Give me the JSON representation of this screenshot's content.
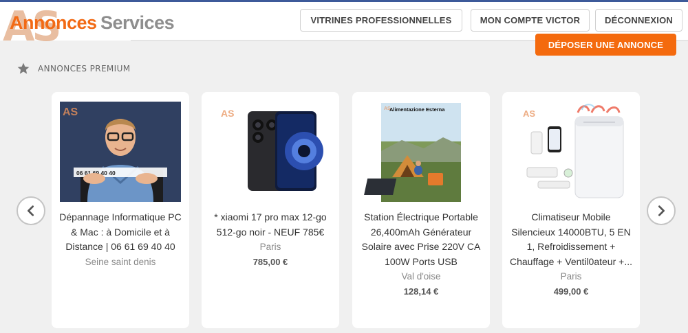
{
  "header": {
    "logo": {
      "mark": "AS",
      "word1": "Annonces",
      "word2": "Services"
    },
    "nav": [
      {
        "label": "VITRINES PROFESSIONNELLES"
      },
      {
        "label": "MON COMPTE VICTOR"
      },
      {
        "label": "DÉCONNEXION"
      }
    ],
    "cta_label": "DÉPOSER UNE ANNONCE"
  },
  "section": {
    "label": "ANNONCES PREMIUM",
    "icon": "star-icon"
  },
  "carousel": {
    "prev_icon": "chevron-left-icon",
    "next_icon": "chevron-right-icon",
    "cards": [
      {
        "title": "Dépannage Informatique PC & Mac : à Domicile et à Distance | 06 61 69 40 40",
        "location": "Seine saint denis",
        "price": "",
        "image_text": "06 61 69 40 40"
      },
      {
        "title": "* xiaomi 17 pro max 12-go 512-go noir - NEUF 785€",
        "location": "Paris",
        "price": "785,00 €",
        "image_text": ""
      },
      {
        "title": "Station Électrique Portable 26,400mAh Générateur Solaire avec Prise 220V CA 100W Ports USB",
        "location": "Val d'oise",
        "price": "128,14 €",
        "image_text": "Alimentazione Esterna"
      },
      {
        "title": "Climatiseur Mobile Silencieux 14000BTU, 5 EN 1, Refroidissement + Chauffage + Ventil0ateur +...",
        "location": "Paris",
        "price": "499,00 €",
        "image_text": ""
      }
    ],
    "watermark": "AS"
  },
  "colors": {
    "accent": "#f46a0e",
    "top_bar": "#3d5a9a",
    "page_bg": "#f0f0f0"
  }
}
